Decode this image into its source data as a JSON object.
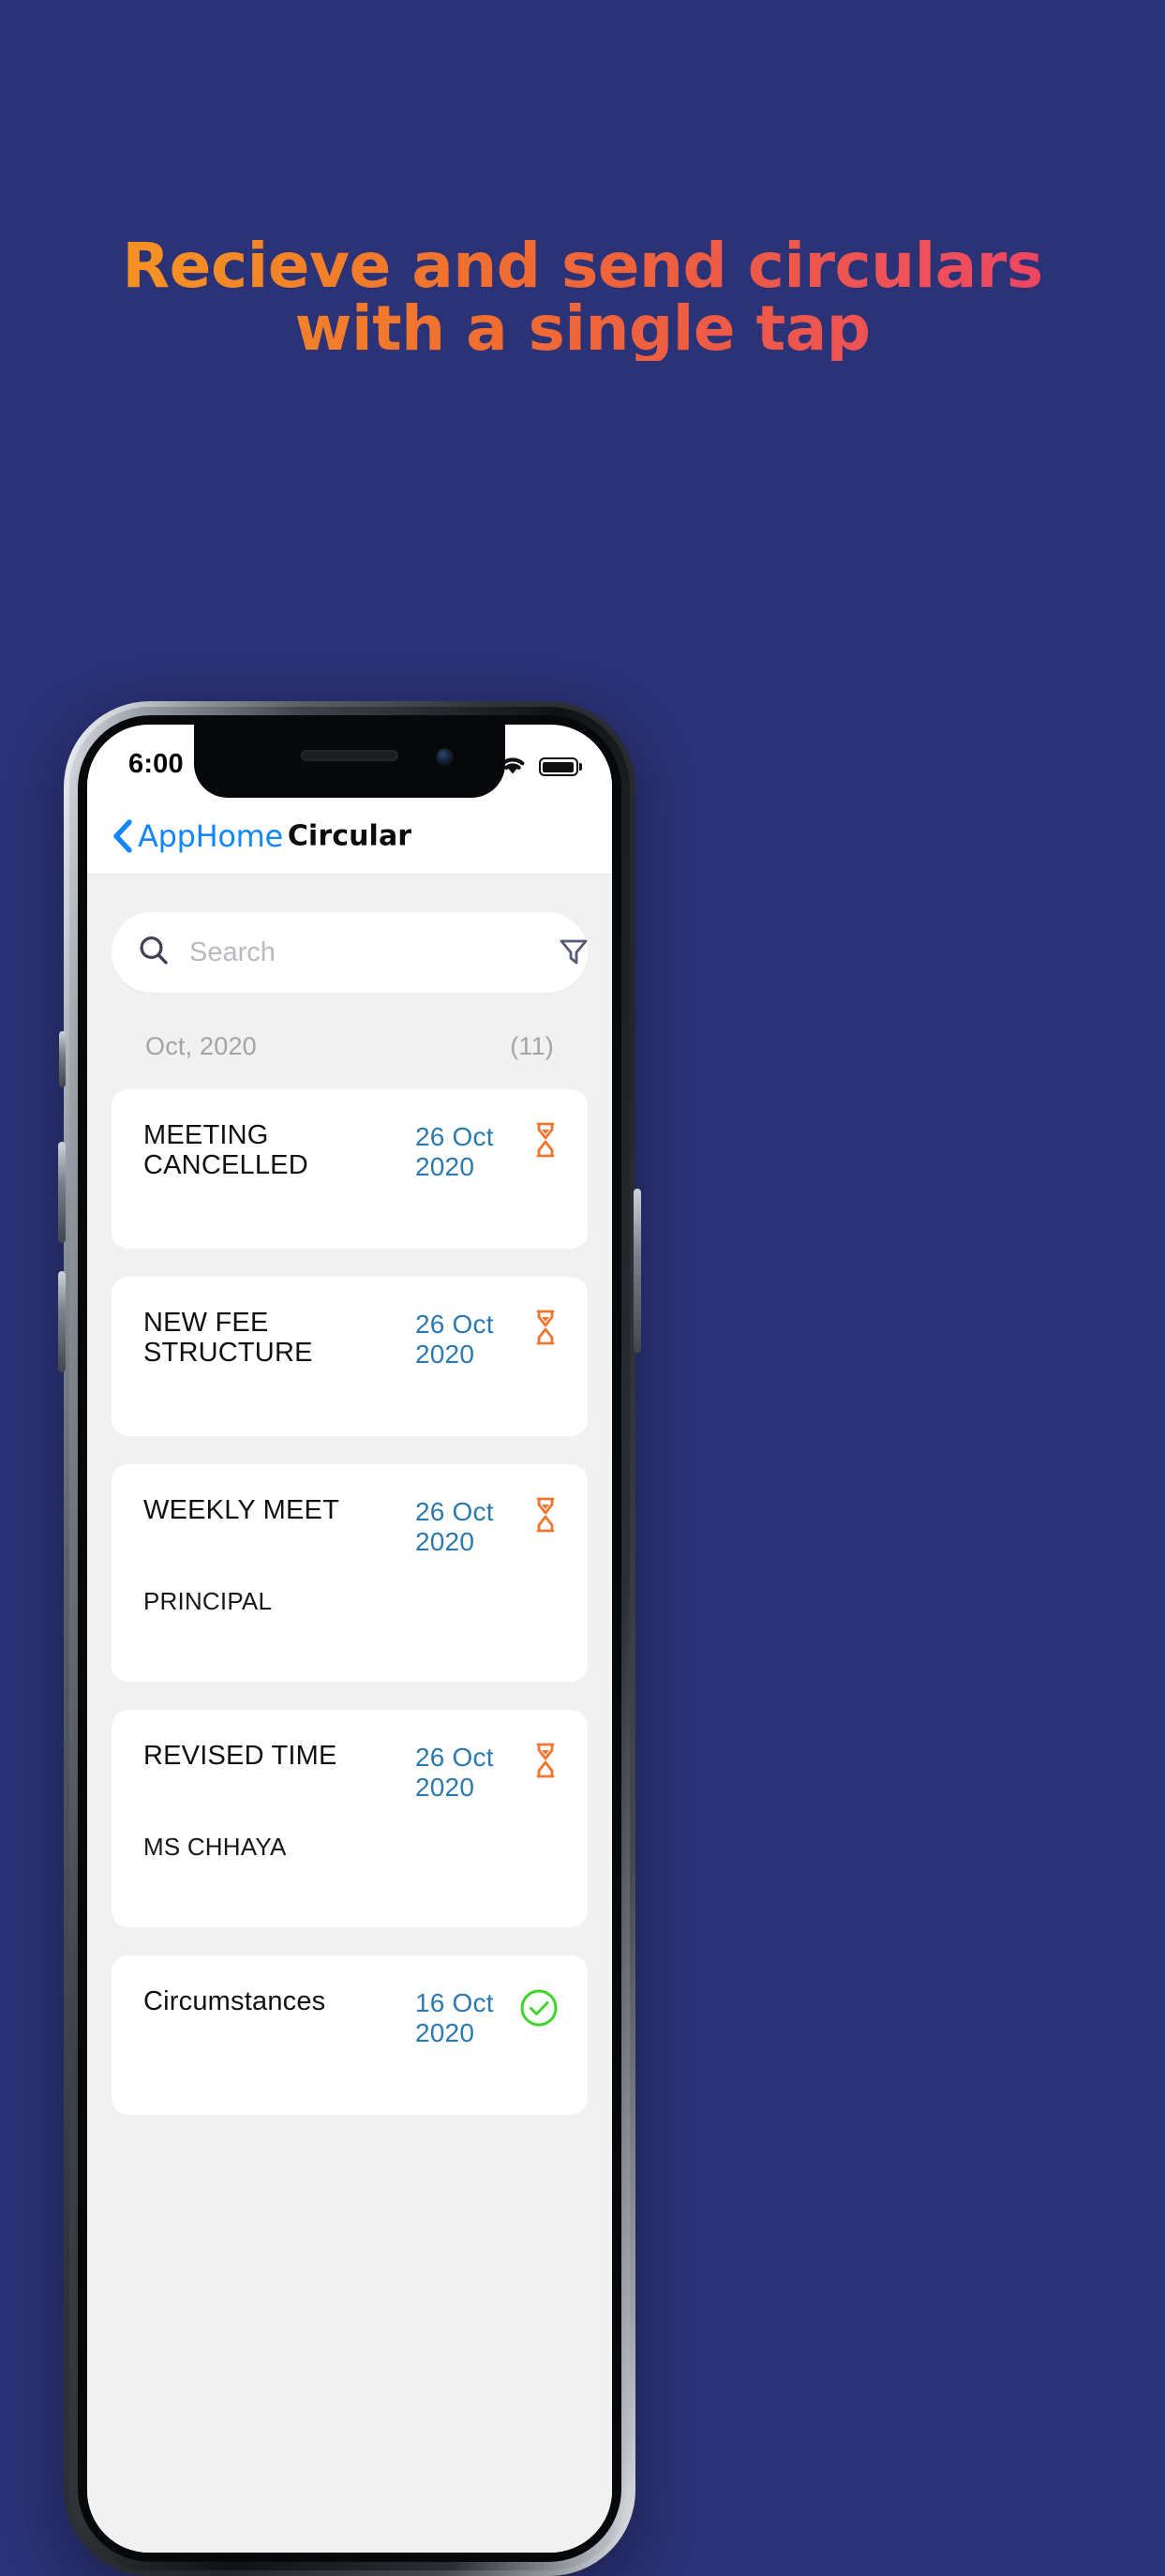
{
  "promo": {
    "headline_line1": "Recieve and send circulars",
    "headline_line2": "with a single tap",
    "background_color": "#2B3276",
    "gradient_start": "#F59124",
    "gradient_end": "#EC3565"
  },
  "status_bar": {
    "time": "6:00",
    "signal_icon": "signal-dots-icon",
    "wifi_icon": "wifi-icon",
    "battery_icon": "battery-full-icon"
  },
  "nav": {
    "back_label": "AppHome",
    "back_icon": "chevron-left-icon",
    "title": "Circular",
    "accent_color": "#1386FC"
  },
  "search": {
    "placeholder": "Search",
    "value": "",
    "search_icon": "search-icon",
    "filter_icon": "filter-icon"
  },
  "section": {
    "month_label": "Oct, 2020",
    "count": "(11)"
  },
  "cards": [
    {
      "title": "MEETING CANCELLED",
      "date": "26 Oct 2020",
      "subtitle": "",
      "status": "pending",
      "status_icon": "hourglass-icon"
    },
    {
      "title": "NEW FEE STRUCTURE",
      "date": "26 Oct 2020",
      "subtitle": "",
      "status": "pending",
      "status_icon": "hourglass-icon"
    },
    {
      "title": "WEEKLY MEET",
      "date": "26 Oct 2020",
      "subtitle": "PRINCIPAL",
      "status": "pending",
      "status_icon": "hourglass-icon"
    },
    {
      "title": "REVISED TIME",
      "date": "26 Oct 2020",
      "subtitle": "MS CHHAYA",
      "status": "pending",
      "status_icon": "hourglass-icon"
    },
    {
      "title": "Circumstances",
      "date": "16 Oct 2020",
      "subtitle": "",
      "status": "approved",
      "status_icon": "check-circle-icon"
    }
  ],
  "colors": {
    "date_blue": "#2A7AB0",
    "pending_orange": "#F0752F",
    "approved_green": "#3FD62A",
    "icon_navy": "#555A7A"
  }
}
